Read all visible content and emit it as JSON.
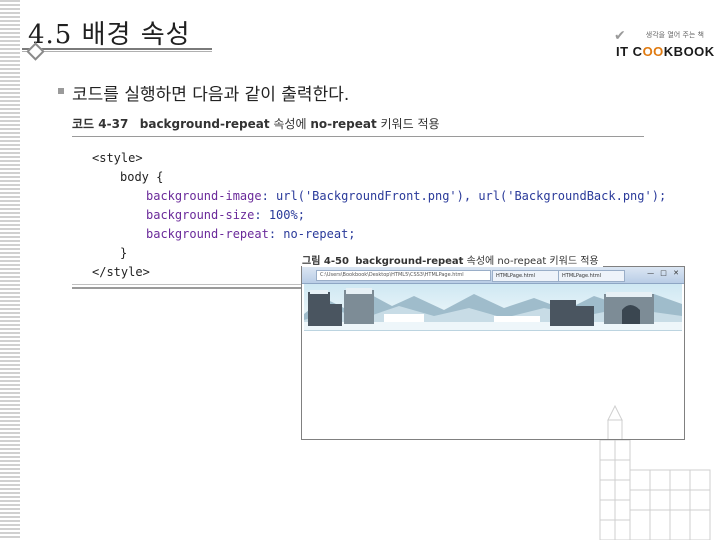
{
  "slide": {
    "title": "4.5 배경 속성",
    "bullet_text": "코드를 실행하면 다음과 같이 출력한다."
  },
  "logo": {
    "subtitle": "생각을 열어 주는 책",
    "wordmark_left": "IT C",
    "wordmark_oo": "OO",
    "wordmark_right": "KBOOK",
    "accent_color": "#e07a10"
  },
  "code_listing": {
    "number": "코드 4-37",
    "caption_bold1": "background-repeat",
    "caption_mid": " 속성에 ",
    "caption_bold2": "no-repeat",
    "caption_end": " 키워드 적용",
    "lines": {
      "l1": "<style>",
      "l2": "body {",
      "l3_prop": "background-image",
      "l3_val": ": url('BackgroundFront.png'), url('BackgroundBack.png');",
      "l4_prop": "background-size",
      "l4_val": ": 100%;",
      "l5_prop": "background-repeat",
      "l5_val": ": no-repeat;",
      "l6": "}",
      "l7": "</style>"
    }
  },
  "figure": {
    "number": "그림 4-50",
    "caption_bold": "background-repeat",
    "caption_rest": " 속성에 no-repeat 키워드 적용",
    "browser": {
      "address": "C:\\Users\\Bookbook\\Desktop\\HTML5\\CSS3\\HTMLPage.html",
      "tab1": "HTMLPage.html",
      "tab2": "HTMLPage.html",
      "window_buttons": "— □ ✕"
    }
  }
}
